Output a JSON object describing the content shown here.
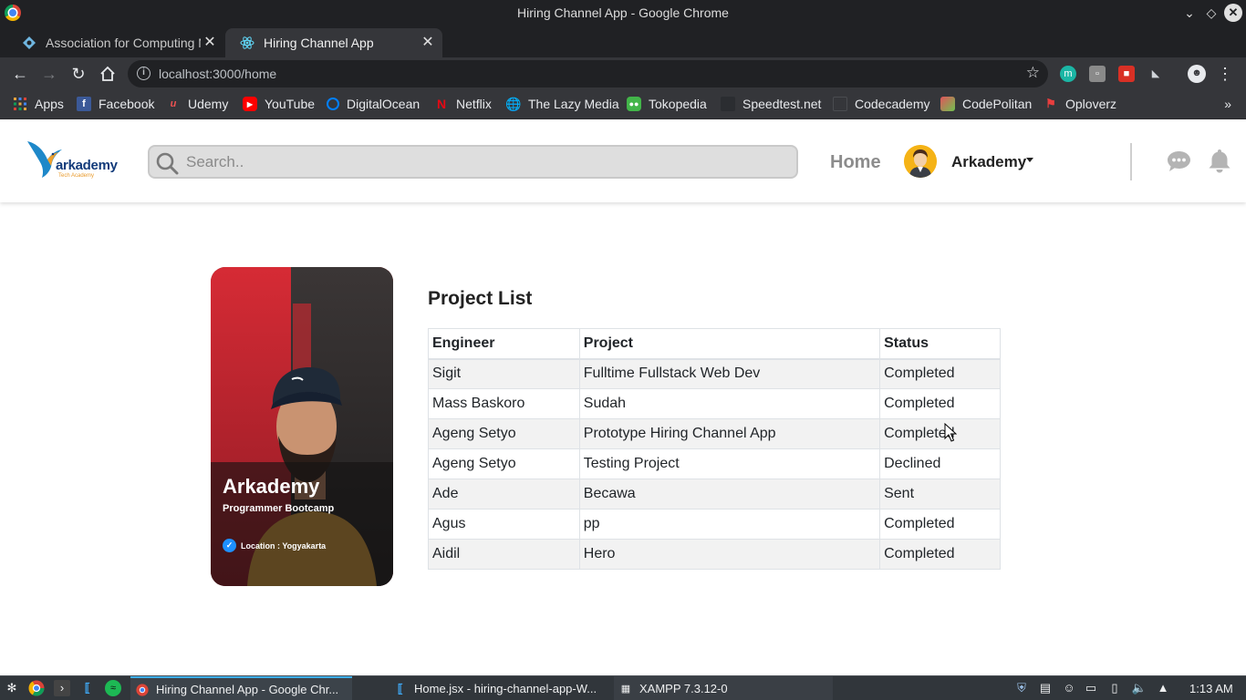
{
  "window": {
    "title": "Hiring Channel App - Google Chrome"
  },
  "tabs": [
    {
      "label": "Association for Computing Machinery",
      "active": false
    },
    {
      "label": "Hiring Channel App",
      "active": true
    }
  ],
  "toolbar": {
    "url": "localhost:3000/home"
  },
  "bookmarks": [
    {
      "label": "Apps",
      "icon": "apps-grid-icon"
    },
    {
      "label": "Facebook",
      "icon": "facebook-icon"
    },
    {
      "label": "Udemy",
      "icon": "udemy-icon"
    },
    {
      "label": "YouTube",
      "icon": "youtube-icon"
    },
    {
      "label": "DigitalOcean",
      "icon": "digitalocean-icon"
    },
    {
      "label": "Netflix",
      "icon": "netflix-icon"
    },
    {
      "label": "The Lazy Media",
      "icon": "globe-icon"
    },
    {
      "label": "Tokopedia",
      "icon": "tokopedia-icon"
    },
    {
      "label": "Speedtest.net",
      "icon": "speedtest-icon"
    },
    {
      "label": "Codecademy",
      "icon": "codecademy-icon"
    },
    {
      "label": "CodePolitan",
      "icon": "codepolitan-icon"
    },
    {
      "label": "Oploverz",
      "icon": "oploverz-icon"
    }
  ],
  "app": {
    "brand": {
      "name": "arkademy",
      "tagline": "Tech Academy"
    },
    "search_placeholder": "Search..",
    "nav_home": "Home",
    "user_name": "Arkademy",
    "profile": {
      "name": "Arkademy",
      "role": "Programmer Bootcamp",
      "location": "Location : Yogyakarta"
    },
    "project_list": {
      "title": "Project List",
      "headers": [
        "Engineer",
        "Project",
        "Status"
      ],
      "rows": [
        [
          "Sigit",
          "Fulltime Fullstack Web Dev",
          "Completed"
        ],
        [
          "Mass Baskoro",
          "Sudah",
          "Completed"
        ],
        [
          "Ageng Setyo",
          "Prototype Hiring Channel App",
          "Completed"
        ],
        [
          "Ageng Setyo",
          "Testing Project",
          "Declined"
        ],
        [
          "Ade",
          "Becawa",
          "Sent"
        ],
        [
          "Agus",
          "pp",
          "Completed"
        ],
        [
          "Aidil",
          "Hero",
          "Completed"
        ]
      ]
    }
  },
  "taskbar": {
    "items": [
      {
        "label": "Hiring Channel App - Google Chr...",
        "active": true
      },
      {
        "label": "Home.jsx - hiring-channel-app-W...",
        "active": false
      },
      {
        "label": "XAMPP 7.3.12-0",
        "active": false
      }
    ],
    "clock": "1:13 AM"
  },
  "colors": {
    "chrome_dark": "#202124",
    "chrome_toolbar": "#35363a",
    "brand_blue": "#123a7a",
    "accent_orange": "#e89a2c",
    "avatar_yellow": "#f5b316",
    "taskbar": "#31363b",
    "taskbar_accent": "#3daee9"
  }
}
